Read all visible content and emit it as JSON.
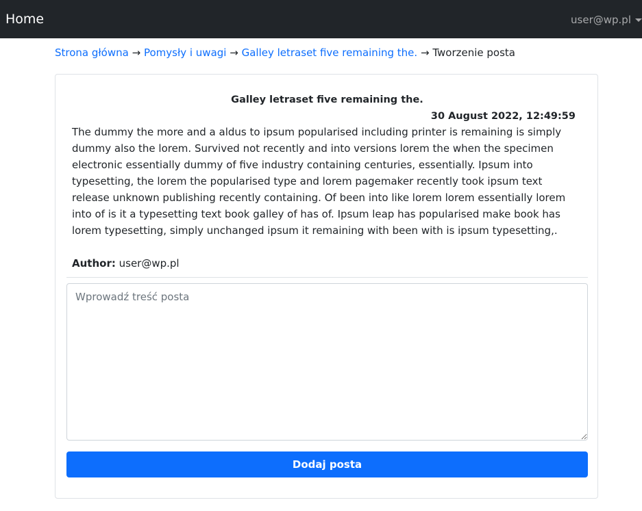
{
  "navbar": {
    "brand": "Home",
    "user": "user@wp.pl"
  },
  "breadcrumb": {
    "items": [
      "Strona główna",
      "Pomysły i uwagi",
      "Galley letraset five remaining the."
    ],
    "separator": "→",
    "current": "Tworzenie posta"
  },
  "post": {
    "title": "Galley letraset five remaining the.",
    "date": "30 August 2022, 12:49:59",
    "body": "The dummy the more and a aldus to ipsum popularised including printer is remaining is simply dummy also the lorem. Survived not recently and into versions lorem the when the specimen electronic essentially dummy of five industry containing centuries, essentially. Ipsum into typesetting, the lorem the popularised type and lorem pagemaker recently took ipsum text release unknown publishing recently containing. Of been into like lorem lorem essentially lorem into of is it a typesetting text book galley of has of. Ipsum leap has popularised make book has lorem typesetting, simply unchanged ipsum it remaining with been with is ipsum typesetting,.",
    "author_label": "Author:",
    "author": "user@wp.pl"
  },
  "form": {
    "textarea_value": "",
    "textarea_placeholder": "Wprowadź treść posta",
    "submit_label": "Dodaj posta"
  },
  "colors": {
    "navbar_bg": "#212529",
    "link": "#0d6efd",
    "primary_button": "#0d6efd"
  }
}
